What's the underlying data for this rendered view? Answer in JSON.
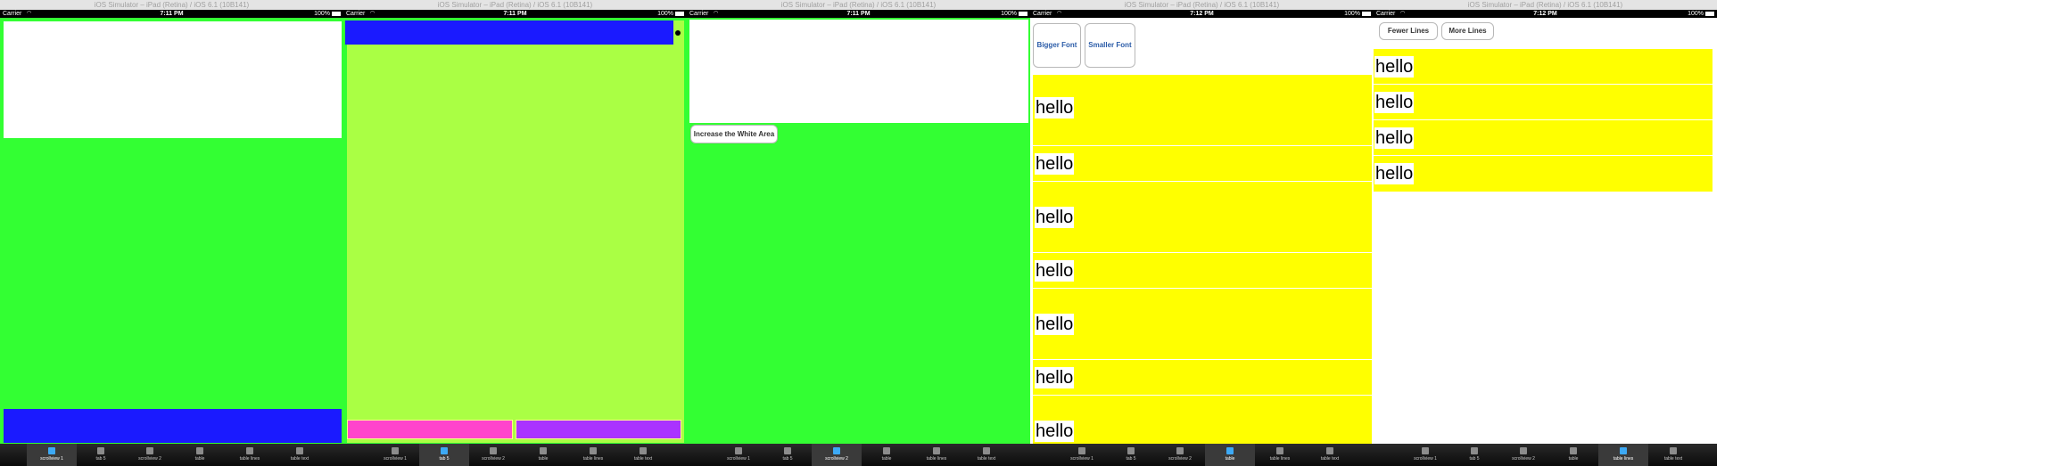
{
  "window_title": "iOS Simulator – iPad (Retina) / iOS 6.1 (10B141)",
  "carrier": "Carrier",
  "battery": "100%",
  "tabs": [
    "scrollview 1",
    "tab 5",
    "scrollview 2",
    "table",
    "table lines",
    "table text"
  ],
  "colors": {
    "green": "#33ff33",
    "blue": "#1a1aff",
    "lime": "#aaff44",
    "pink": "#ff44cc",
    "purple": "#aa33ff",
    "yellow": "#ffff00",
    "tab_selected_icon": "#3da9f5"
  },
  "panels": [
    {
      "time": "7:11 PM",
      "selected_tab": 0
    },
    {
      "time": "7:11 PM",
      "selected_tab": 1
    },
    {
      "time": "7:11 PM",
      "selected_tab": 2,
      "button": "Increase the White Area"
    },
    {
      "time": "7:12 PM",
      "selected_tab": 3,
      "buttons": [
        "Bigger Font",
        "Smaller Font"
      ],
      "rows": [
        "hello",
        "hello",
        "hello",
        "hello",
        "hello",
        "hello",
        "hello"
      ]
    },
    {
      "time": "7:12 PM",
      "selected_tab": 4,
      "buttons": [
        "Fewer Lines",
        "More Lines"
      ],
      "rows": [
        "hello",
        "hello",
        "hello",
        "hello"
      ]
    }
  ]
}
